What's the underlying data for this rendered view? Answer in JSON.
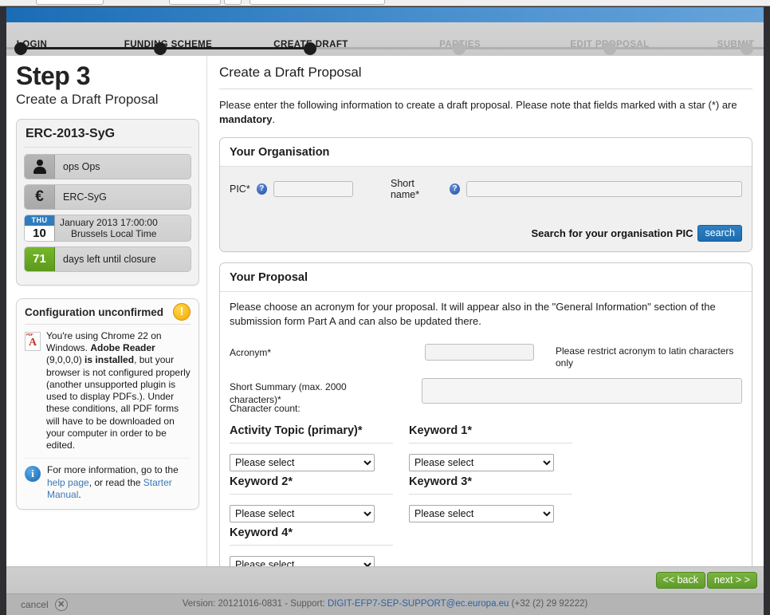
{
  "stepper": {
    "steps": [
      {
        "label": "LOGIN",
        "state": "done"
      },
      {
        "label": "FUNDING SCHEME",
        "state": "done"
      },
      {
        "label": "CREATE DRAFT",
        "state": "current"
      },
      {
        "label": "PARTIES",
        "state": "upcoming"
      },
      {
        "label": "EDIT PROPOSAL",
        "state": "upcoming"
      },
      {
        "label": "SUBMIT",
        "state": "upcoming"
      }
    ]
  },
  "sidebar": {
    "step_title": "Step 3",
    "step_subtitle": "Create a Draft Proposal",
    "call_card": {
      "title": "ERC-2013-SyG",
      "rows": [
        {
          "icon": "person-icon",
          "text": "ops Ops"
        },
        {
          "icon": "euro-icon",
          "text": "ERC-SyG"
        },
        {
          "icon": "calendar-icon",
          "weekday": "THU",
          "day": "10",
          "line1": "January 2013 17:00:00",
          "line2": "Brussels Local Time"
        },
        {
          "icon": "days-left-icon",
          "count": "71",
          "text": "days left until closure"
        }
      ]
    },
    "config": {
      "title": "Configuration unconfirmed",
      "warning_icon": "!",
      "body_prefix": "You're using Chrome 22 on Windows. ",
      "body_bold1": "Adobe Reader",
      "body_mid": " (9,0,0,0) ",
      "body_bold2": "is installed",
      "body_suffix": ", but your browser is not configured properly (another unsupported plugin is used to display PDFs.). Under these conditions, all PDF forms will have to be downloaded on your computer in order to be edited.",
      "more_prefix": "For more information, go to the ",
      "link_help": "help page",
      "more_mid": ", or read the ",
      "link_manual": "Starter Manual",
      "more_suffix": "."
    }
  },
  "main": {
    "title": "Create a Draft Proposal",
    "intro_prefix": "Please enter the following information to create a draft proposal. Please note that fields marked with a star (*) are ",
    "intro_bold": "mandatory",
    "intro_suffix": ".",
    "organisation": {
      "panel_title": "Your Organisation",
      "pic_label": "PIC*",
      "pic_value": "",
      "pic_help": "?",
      "shortname_label": "Short name*",
      "shortname_value": "",
      "shortname_help": "?",
      "search_label": "Search for your organisation PIC",
      "search_button": "search"
    },
    "proposal": {
      "panel_title": "Your Proposal",
      "intro": "Please choose an acronym for your proposal. It will appear also in the \"General Information\" section of the submission form Part A and can also be updated there.",
      "acronym_label": "Acronym*",
      "acronym_value": "",
      "acronym_hint": "Please restrict acronym to latin characters only",
      "summary_label_l1": "Short Summary (max. 2000",
      "summary_label_l2": "characters)*",
      "summary_charcount": "Character count:",
      "summary_value": "",
      "selects": [
        {
          "label": "Activity Topic (primary)*",
          "value": "Please select"
        },
        {
          "label": "Keyword 1*",
          "value": "Please select"
        },
        {
          "label": "Keyword 2*",
          "value": "Please select"
        },
        {
          "label": "Keyword 3*",
          "value": "Please select"
        },
        {
          "label": "Keyword 4*",
          "value": "Please select"
        }
      ]
    }
  },
  "footer": {
    "back_label": "<< back",
    "next_label": "next > >",
    "cancel_label": "cancel",
    "cancel_icon": "✕",
    "version_prefix": "Version: 20121016-0831 - Support: ",
    "support_email": "DIGIT-EFP7-SEP-SUPPORT@ec.europa.eu",
    "version_suffix": " (+32 (2) 29 92222)"
  },
  "colors": {
    "brand_blue": "#2e7cc0",
    "accent_green": "#5f9c2a",
    "warning_amber": "#f5a800",
    "link_blue": "#3a78b5"
  }
}
